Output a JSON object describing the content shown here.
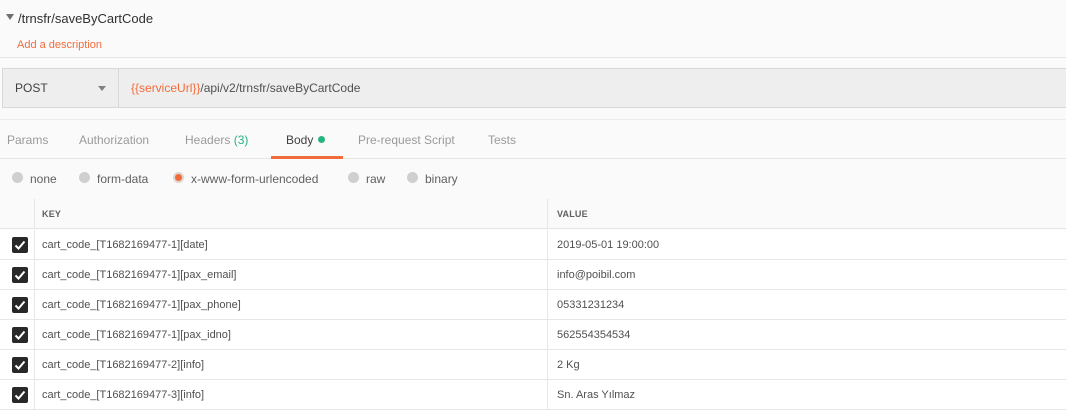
{
  "request": {
    "name": "/trnsfr/saveByCartCode",
    "add_description": "Add a description"
  },
  "url_bar": {
    "method": "POST",
    "url_variable": "{{serviceUrl}}",
    "url_path": "/api/v2/trnsfr/saveByCartCode"
  },
  "tabs": {
    "params": "Params",
    "authorization": "Authorization",
    "headers": "Headers",
    "headers_count": "(3)",
    "body": "Body",
    "prerequest": "Pre-request Script",
    "tests": "Tests"
  },
  "body_types": {
    "none": "none",
    "form_data": "form-data",
    "urlencoded": "x-www-form-urlencoded",
    "raw": "raw",
    "binary": "binary",
    "selected": "x-www-form-urlencoded"
  },
  "table": {
    "col_key": "KEY",
    "col_value": "VALUE",
    "rows": [
      {
        "key": "cart_code_[T1682169477-1][date]",
        "value": "2019-05-01 19:00:00"
      },
      {
        "key": "cart_code_[T1682169477-1][pax_email]",
        "value": "info@poibil.com"
      },
      {
        "key": "cart_code_[T1682169477-1][pax_phone]",
        "value": "05331231234"
      },
      {
        "key": "cart_code_[T1682169477-1][pax_idno]",
        "value": "562554354534"
      },
      {
        "key": "cart_code_[T1682169477-2][info]",
        "value": "2 Kg"
      },
      {
        "key": "cart_code_[T1682169477-3][info]",
        "value": "Sn. Aras Yılmaz"
      }
    ]
  },
  "colors": {
    "accent": "#f26b3a",
    "success": "#26b47f"
  },
  "icons": {
    "caret": "caret-down-icon",
    "checkbox": "checkbox-checked-icon"
  }
}
